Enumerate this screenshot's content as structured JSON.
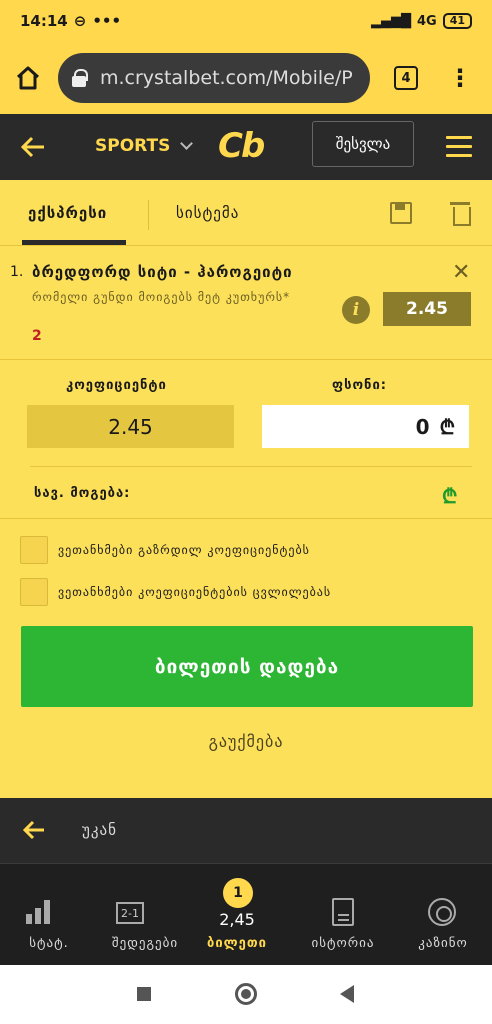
{
  "status": {
    "time": "14:14",
    "network": "4G",
    "battery": "41"
  },
  "browser": {
    "url": "m.crystalbet.com/Mobile/P",
    "tab_count": "4"
  },
  "header": {
    "sports_label": "SPORTS",
    "logo_text": "Cb",
    "login_label": "შესვლა"
  },
  "betslip": {
    "tab_express": "ექსპრესი",
    "tab_system": "სისტემა",
    "selection": {
      "number": "1.",
      "match": "ბრედფორდ სიტი - ჰაროგეიტი",
      "market": "რომელი გუნდი მოიგებს მეტ კუთხურს*",
      "outcome": "2",
      "odds": "2.45"
    },
    "coef_label": "კოეფიციენტი",
    "stake_label": "ფსონი:",
    "coef_value": "2.45",
    "stake_value": "0",
    "currency": "₾",
    "possible_win_label": "სავ. მოგება:",
    "possible_win_currency": "₾",
    "checkbox_1": "ვეთანხმები გაზრდილ კოეფიციენტებს",
    "checkbox_2": "ვეთანხმები კოეფიციენტების ცვლილებას",
    "place_bet": "ბილეთის დადება",
    "cancel": "გაუქმება"
  },
  "backbar": {
    "label": "უკან"
  },
  "bottom_nav": {
    "stats": "სტატ.",
    "matches": "შედეგები",
    "box_text": "2-1",
    "slip": "ბილეთი",
    "slip_badge": "1",
    "slip_value": "2,45",
    "history": "ისტორია",
    "casino": "კაზინო"
  },
  "colors": {
    "accent": "#ffd84d",
    "panel": "#fde05a",
    "dark": "#2a2a2a",
    "success": "#2db534"
  }
}
